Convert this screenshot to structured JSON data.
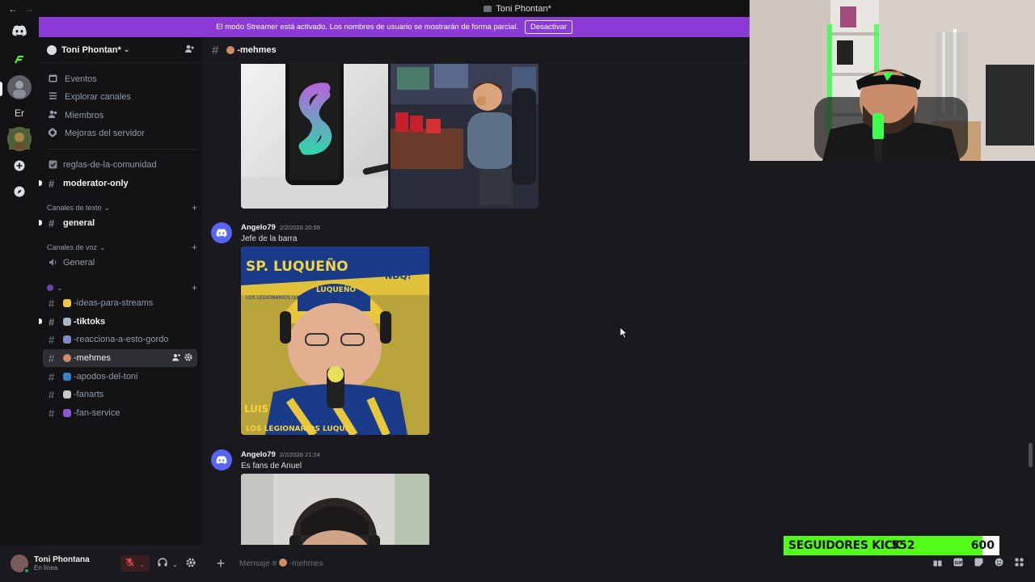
{
  "titlebar": {
    "back": "←",
    "forward": "→",
    "title": "Toni Phontan*"
  },
  "rail": {
    "servers": [
      {
        "name": "home"
      },
      {
        "name": "green-server"
      },
      {
        "name": "avatar-server"
      },
      {
        "label": "Er"
      },
      {
        "name": "game-server"
      },
      {
        "name": "add-server"
      },
      {
        "name": "discover"
      }
    ]
  },
  "banner": {
    "text": "El modo Streamer está activado. Los nombres de usuario se mostrarán de forma parcial.",
    "button": "Desactivar"
  },
  "guild": {
    "name": "Toni Phontan*",
    "chevron": "⌄"
  },
  "nav": [
    {
      "label": "Eventos",
      "icon": "calendar-icon"
    },
    {
      "label": "Explorar canales",
      "icon": "browse-icon"
    },
    {
      "label": "Miembros",
      "icon": "members-icon"
    },
    {
      "label": "Mejoras del servidor",
      "icon": "boost-icon"
    }
  ],
  "channels_top": [
    {
      "name": "reglas-de-la-comunidad",
      "icon": "rules-icon"
    },
    {
      "name": "moderator-only",
      "unread": true
    }
  ],
  "categories": {
    "text": "Canales de texto",
    "voice": "Canales de voz",
    "third": "⌄"
  },
  "text_channels": [
    {
      "name": "general",
      "unread": true
    }
  ],
  "voice_channels": [
    {
      "name": "General"
    }
  ],
  "emoji_channels": [
    {
      "name": "-ideas-para-streams",
      "emoji_color": "#f4c542"
    },
    {
      "name": "-tiktoks",
      "emoji_color": "#aab4c8",
      "unread": true
    },
    {
      "name": "-reacciona-a-esto-gordo",
      "emoji_color": "#7c8cc8"
    },
    {
      "name": "-mehmes",
      "emoji_color": "#d08c6a",
      "active": true
    },
    {
      "name": "-apodos-del-toni",
      "emoji_color": "#3b82c4"
    },
    {
      "name": "-fanarts",
      "emoji_color": "#c8c8c8"
    },
    {
      "name": "-fan-service",
      "emoji_color": "#8a5ad0"
    }
  ],
  "user": {
    "name": "Toni Phontana",
    "status": "En línea"
  },
  "chat": {
    "channel": "-mehmes",
    "messages": [
      {
        "author": "Angelo79",
        "time": "2/2/2026 20:59",
        "text": "Jefe de la barra"
      },
      {
        "author": "Angelo79",
        "time": "2/2/2026 21:24",
        "text": "Es fans de Anuel"
      }
    ],
    "image_text": {
      "scarf_top": "SP. LUQUEÑO",
      "scarf_right": "NDQ!",
      "cap": "LUQUEÑO",
      "hat_small": "LOS LEGIONARIOS LUQUE",
      "scarf_bottom": "LOS LEGIONARIOS LUQUE",
      "scarf_left": "LUIS"
    }
  },
  "composer": {
    "placeholder": "Mensaje # ",
    "channel": "-mehmes"
  },
  "kick": {
    "label": "SEGUIDORES KICK",
    "current": "552",
    "goal": "600",
    "progress": 0.92
  },
  "colors": {
    "accent": "#5865f2",
    "banner": "#8a3bd4",
    "kick_green": "#53fc18"
  }
}
